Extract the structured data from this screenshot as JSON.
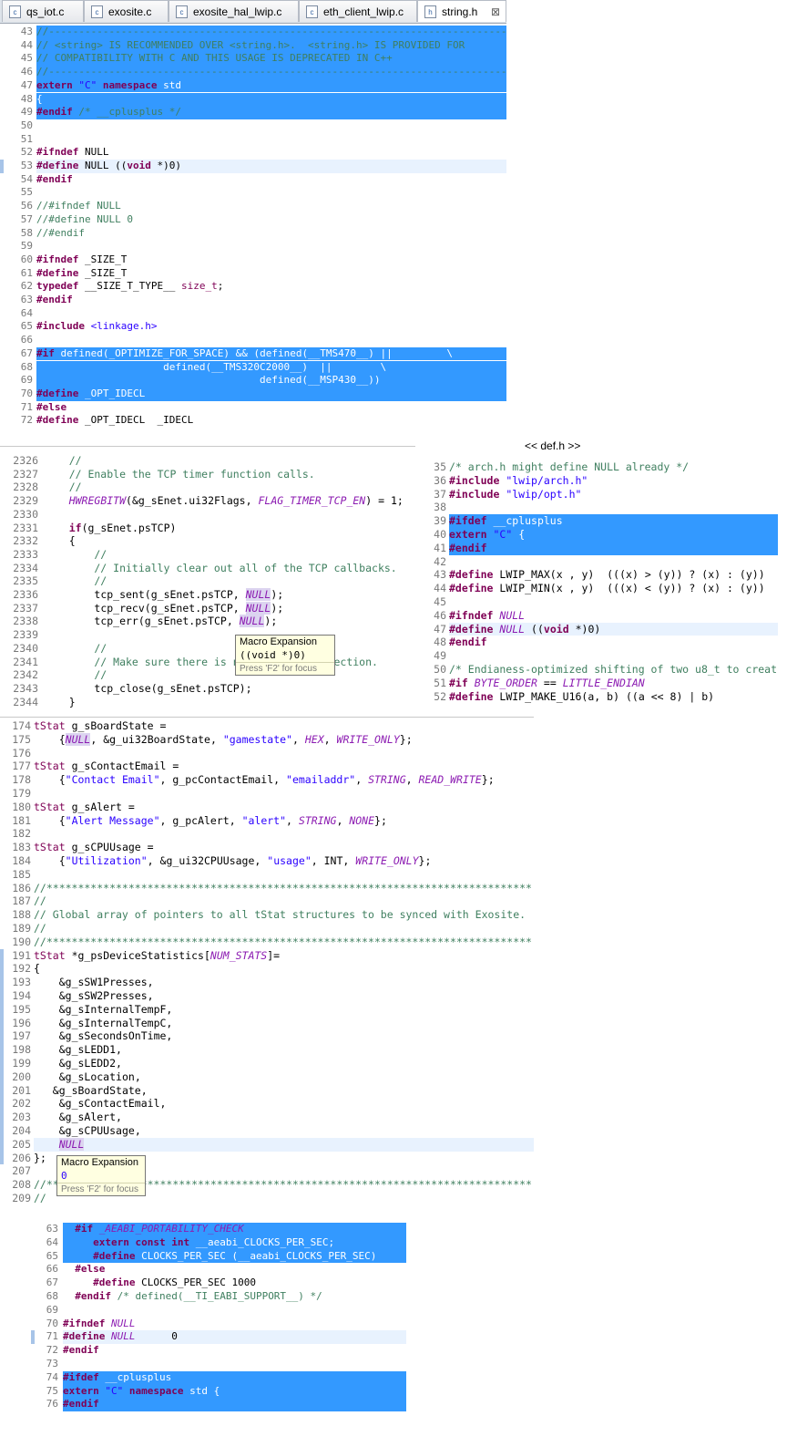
{
  "tabs": [
    {
      "label": "qs_iot.c",
      "icon": "c-file-icon"
    },
    {
      "label": "exosite.c",
      "icon": "c-file-icon"
    },
    {
      "label": "exosite_hal_lwip.c",
      "icon": "c-file-icon"
    },
    {
      "label": "eth_client_lwip.c",
      "icon": "c-file-icon"
    },
    {
      "label": "string.h",
      "icon": "h-file-icon",
      "active": true,
      "close": "⊠"
    }
  ],
  "panel_b_title": "<< def.h >>",
  "tooltip1": {
    "title": "Macro Expansion",
    "text": "((void *)0)",
    "hint": "Press 'F2' for focus"
  },
  "tooltip2": {
    "title": "Macro Expansion",
    "text": "0",
    "hint": "Press 'F2' for focus"
  },
  "panel_string_h": [
    [
      "43",
      "//-----------------------------------------------------------------------------"
    ],
    [
      "44",
      "// <string> IS RECOMMENDED OVER <string.h>.  <string.h> IS PROVIDED FOR"
    ],
    [
      "45",
      "// COMPATIBILITY WITH C AND THIS USAGE IS DEPRECATED IN C++"
    ],
    [
      "46",
      "//-----------------------------------------------------------------------------"
    ],
    [
      "47",
      "extern \"C\" namespace std"
    ],
    [
      "48",
      "{"
    ],
    [
      "49",
      "#endif /* __cplusplus */"
    ],
    [
      "50",
      ""
    ],
    [
      "51",
      ""
    ],
    [
      "52",
      "#ifndef NULL"
    ],
    [
      "53",
      "#define NULL ((void *)0)"
    ],
    [
      "54",
      "#endif"
    ],
    [
      "55",
      ""
    ],
    [
      "56",
      "//#ifndef NULL"
    ],
    [
      "57",
      "//#define NULL 0"
    ],
    [
      "58",
      "//#endif"
    ],
    [
      "59",
      ""
    ],
    [
      "60",
      "#ifndef _SIZE_T"
    ],
    [
      "61",
      "#define _SIZE_T"
    ],
    [
      "62",
      "typedef __SIZE_T_TYPE__ size_t;"
    ],
    [
      "63",
      "#endif"
    ],
    [
      "64",
      ""
    ],
    [
      "65",
      "#include <linkage.h>"
    ],
    [
      "66",
      ""
    ],
    [
      "67",
      "#if defined(_OPTIMIZE_FOR_SPACE) && (defined(__TMS470__) ||         \\"
    ],
    [
      "68",
      "                     defined(__TMS320C2000__)  ||        \\"
    ],
    [
      "69",
      "                                     defined(__MSP430__))"
    ],
    [
      "70",
      "#define _OPT_IDECL"
    ],
    [
      "71",
      "#else"
    ],
    [
      "72",
      "#define _OPT_IDECL  _IDECL"
    ]
  ],
  "panel_tcp": [
    [
      "2326",
      "    //"
    ],
    [
      "2327",
      "    // Enable the TCP timer function calls."
    ],
    [
      "2328",
      "    //"
    ],
    [
      "2329",
      "    HWREGBITW(&g_sEnet.ui32Flags, FLAG_TIMER_TCP_EN) = 1;"
    ],
    [
      "2330",
      ""
    ],
    [
      "2331",
      "    if(g_sEnet.psTCP)"
    ],
    [
      "2332",
      "    {"
    ],
    [
      "2333",
      "        //"
    ],
    [
      "2334",
      "        // Initially clear out all of the TCP callbacks."
    ],
    [
      "2335",
      "        //"
    ],
    [
      "2336",
      "        tcp_sent(g_sEnet.psTCP, NULL);"
    ],
    [
      "2337",
      "        tcp_recv(g_sEnet.psTCP, NULL);"
    ],
    [
      "2338",
      "        tcp_err(g_sEnet.psTCP, NULL);"
    ],
    [
      "2339",
      ""
    ],
    [
      "2340",
      "        //"
    ],
    [
      "2341",
      "        // Make sure there is no open TCP connection."
    ],
    [
      "2342",
      "        //"
    ],
    [
      "2343",
      "        tcp_close(g_sEnet.psTCP);"
    ],
    [
      "2344",
      "    }"
    ]
  ],
  "panel_def_h": [
    [
      "35",
      "/* arch.h might define NULL already */"
    ],
    [
      "36",
      "#include \"lwip/arch.h\""
    ],
    [
      "37",
      "#include \"lwip/opt.h\""
    ],
    [
      "38",
      ""
    ],
    [
      "39",
      "#ifdef __cplusplus"
    ],
    [
      "40",
      "extern \"C\" {"
    ],
    [
      "41",
      "#endif"
    ],
    [
      "42",
      ""
    ],
    [
      "43",
      "#define LWIP_MAX(x , y)  (((x) > (y)) ? (x) : (y))"
    ],
    [
      "44",
      "#define LWIP_MIN(x , y)  (((x) < (y)) ? (x) : (y))"
    ],
    [
      "45",
      ""
    ],
    [
      "46",
      "#ifndef NULL"
    ],
    [
      "47",
      "#define NULL ((void *)0)"
    ],
    [
      "48",
      "#endif"
    ],
    [
      "49",
      ""
    ],
    [
      "50",
      "/* Endianess-optimized shifting of two u8_t to creat"
    ],
    [
      "51",
      "#if BYTE_ORDER == LITTLE_ENDIAN"
    ],
    [
      "52",
      "#define LWIP_MAKE_U16(a, b) ((a << 8) | b)"
    ]
  ],
  "panel_exosite": [
    [
      "174",
      "tStat g_sBoardState ="
    ],
    [
      "175",
      "    {NULL, &g_ui32BoardState, \"gamestate\", HEX, WRITE_ONLY};"
    ],
    [
      "176",
      ""
    ],
    [
      "177",
      "tStat g_sContactEmail ="
    ],
    [
      "178",
      "    {\"Contact Email\", g_pcContactEmail, \"emailaddr\", STRING, READ_WRITE};"
    ],
    [
      "179",
      ""
    ],
    [
      "180",
      "tStat g_sAlert ="
    ],
    [
      "181",
      "    {\"Alert Message\", g_pcAlert, \"alert\", STRING, NONE};"
    ],
    [
      "182",
      ""
    ],
    [
      "183",
      "tStat g_sCPUUsage ="
    ],
    [
      "184",
      "    {\"Utilization\", &g_ui32CPUUsage, \"usage\", INT, WRITE_ONLY};"
    ],
    [
      "185",
      ""
    ],
    [
      "186",
      "//*****************************************************************************"
    ],
    [
      "187",
      "//"
    ],
    [
      "188",
      "// Global array of pointers to all tStat structures to be synced with Exosite."
    ],
    [
      "189",
      "//"
    ],
    [
      "190",
      "//*****************************************************************************"
    ],
    [
      "191",
      "tStat *g_psDeviceStatistics[NUM_STATS]="
    ],
    [
      "192",
      "{"
    ],
    [
      "193",
      "    &g_sSW1Presses,"
    ],
    [
      "194",
      "    &g_sSW2Presses,"
    ],
    [
      "195",
      "    &g_sInternalTempF,"
    ],
    [
      "196",
      "    &g_sInternalTempC,"
    ],
    [
      "197",
      "    &g_sSecondsOnTime,"
    ],
    [
      "198",
      "    &g_sLEDD1,"
    ],
    [
      "199",
      "    &g_sLEDD2,"
    ],
    [
      "200",
      "    &g_sLocation,"
    ],
    [
      "201",
      "   &g_sBoardState,"
    ],
    [
      "202",
      "    &g_sContactEmail,"
    ],
    [
      "203",
      "    &g_sAlert,"
    ],
    [
      "204",
      "    &g_sCPUUsage,"
    ],
    [
      "205",
      "    NULL"
    ],
    [
      "206",
      "};"
    ],
    [
      "207",
      ""
    ],
    [
      "208",
      "//*****************************************************************************"
    ],
    [
      "209",
      "//"
    ]
  ],
  "panel_time_h": [
    [
      "63",
      "  #if _AEABI_PORTABILITY_CHECK"
    ],
    [
      "64",
      "     extern const int __aeabi_CLOCKS_PER_SEC;"
    ],
    [
      "65",
      "     #define CLOCKS_PER_SEC (__aeabi_CLOCKS_PER_SEC)"
    ],
    [
      "66",
      "  #else"
    ],
    [
      "67",
      "     #define CLOCKS_PER_SEC 1000"
    ],
    [
      "68",
      "  #endif /* defined(__TI_EABI_SUPPORT__) */"
    ],
    [
      "69",
      ""
    ],
    [
      "70",
      "#ifndef NULL"
    ],
    [
      "71",
      "#define NULL      0"
    ],
    [
      "72",
      "#endif"
    ],
    [
      "73",
      ""
    ],
    [
      "74",
      "#ifdef __cplusplus"
    ],
    [
      "75",
      "extern \"C\" namespace std {"
    ],
    [
      "76",
      "#endif"
    ]
  ]
}
